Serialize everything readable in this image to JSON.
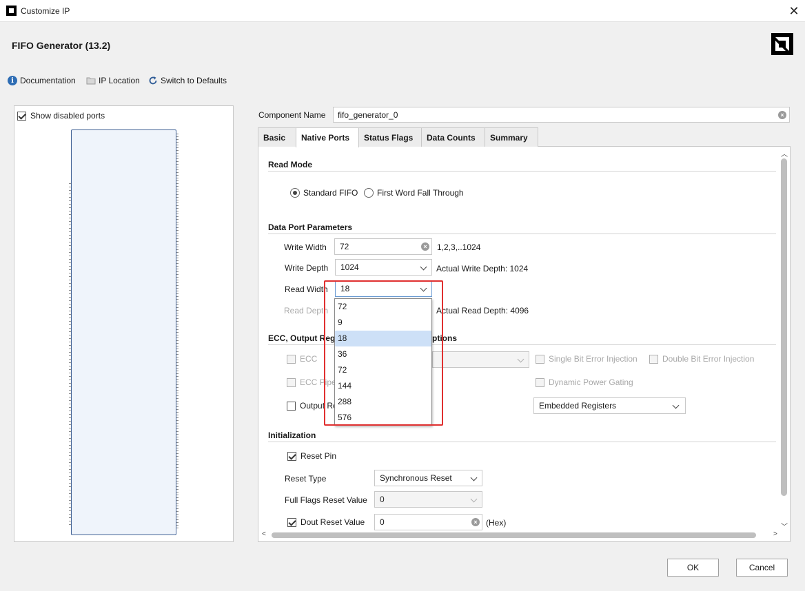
{
  "window": {
    "title": "Customize IP",
    "close_glyph": "✕"
  },
  "header": {
    "ip_title": "FIFO Generator (13.2)"
  },
  "toolbar": {
    "documentation": "Documentation",
    "ip_location": "IP Location",
    "switch_defaults": "Switch to Defaults"
  },
  "left_panel": {
    "show_disabled_ports": "Show disabled ports",
    "show_disabled_checked": true
  },
  "component": {
    "label": "Component Name",
    "value": "fifo_generator_0"
  },
  "tabs": [
    {
      "label": "Basic",
      "active": false
    },
    {
      "label": "Native Ports",
      "active": true
    },
    {
      "label": "Status Flags",
      "active": false
    },
    {
      "label": "Data Counts",
      "active": false
    },
    {
      "label": "Summary",
      "active": false
    }
  ],
  "read_mode": {
    "heading": "Read Mode",
    "options": [
      "Standard FIFO",
      "First Word Fall Through"
    ],
    "selected": "Standard FIFO"
  },
  "data_port": {
    "heading": "Data Port Parameters",
    "write_width_label": "Write Width",
    "write_width_value": "72",
    "write_width_hint": "1,2,3,..1024",
    "write_depth_label": "Write Depth",
    "write_depth_value": "1024",
    "write_depth_hint": "Actual Write Depth: 1024",
    "read_width_label": "Read Width",
    "read_width_value": "18",
    "read_depth_label": "Read Depth",
    "read_depth_hint": "Actual Read Depth: 4096"
  },
  "read_width_options": [
    "72",
    "9",
    "18",
    "36",
    "72",
    "144",
    "288",
    "576"
  ],
  "read_width_selected_index": 2,
  "ecc": {
    "heading_left": "ECC, Output Regi",
    "heading_right": "ptions",
    "ecc_label": "ECC",
    "ecc_pipe_label": "ECC Pipe",
    "output_reg_label": "Output Re",
    "single_bit": "Single Bit Error Injection",
    "double_bit": "Double Bit Error Injection",
    "dynamic_power": "Dynamic Power Gating",
    "register_type": "Embedded Registers"
  },
  "init": {
    "heading": "Initialization",
    "reset_pin": "Reset Pin",
    "reset_type_label": "Reset Type",
    "reset_type_value": "Synchronous Reset",
    "full_flags_label": "Full Flags Reset Value",
    "full_flags_value": "0",
    "dout_label": "Dout Reset Value",
    "dout_value": "0",
    "dout_unit": "(Hex)"
  },
  "buttons": {
    "ok": "OK",
    "cancel": "Cancel"
  }
}
